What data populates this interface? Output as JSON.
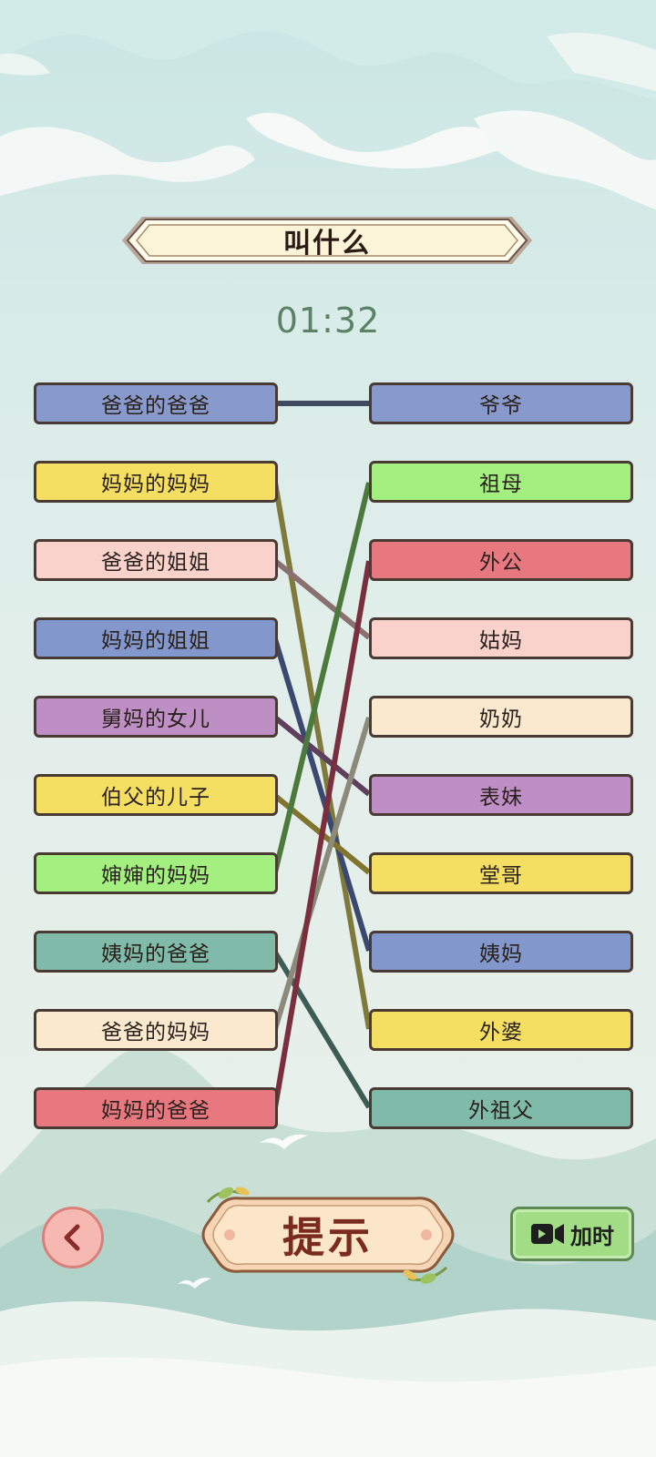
{
  "title": "叫什么",
  "timer": "01:32",
  "left_items": [
    {
      "label": "爸爸的爸爸",
      "color": "#8899cc"
    },
    {
      "label": "妈妈的妈妈",
      "color": "#f4df62"
    },
    {
      "label": "爸爸的姐姐",
      "color": "#f8d2cb"
    },
    {
      "label": "妈妈的姐姐",
      "color": "#8297cb"
    },
    {
      "label": "舅妈的女儿",
      "color": "#be8fc4"
    },
    {
      "label": "伯父的儿子",
      "color": "#f4df62"
    },
    {
      "label": "婶婶的妈妈",
      "color": "#a3ef7f"
    },
    {
      "label": "姨妈的爸爸",
      "color": "#80bba9"
    },
    {
      "label": "爸爸的妈妈",
      "color": "#fbe9cf"
    },
    {
      "label": "妈妈的爸爸",
      "color": "#e87880"
    }
  ],
  "right_items": [
    {
      "label": "爷爷",
      "color": "#8899cc"
    },
    {
      "label": "祖母",
      "color": "#a3ef7f"
    },
    {
      "label": "外公",
      "color": "#e87880"
    },
    {
      "label": "姑妈",
      "color": "#f8d2cb"
    },
    {
      "label": "奶奶",
      "color": "#fbe9cf"
    },
    {
      "label": "表妹",
      "color": "#be8fc4"
    },
    {
      "label": "堂哥",
      "color": "#f4df62"
    },
    {
      "label": "姨妈",
      "color": "#8297cb"
    },
    {
      "label": "外婆",
      "color": "#f4df62"
    },
    {
      "label": "外祖父",
      "color": "#80bba9"
    }
  ],
  "connections": [
    {
      "from": 0,
      "to": 0,
      "color": "#3f4a5f"
    },
    {
      "from": 1,
      "to": 8,
      "color": "#7f7a3c"
    },
    {
      "from": 2,
      "to": 3,
      "color": "#8a7070"
    },
    {
      "from": 3,
      "to": 7,
      "color": "#3b4870"
    },
    {
      "from": 4,
      "to": 5,
      "color": "#5e3f5e"
    },
    {
      "from": 5,
      "to": 6,
      "color": "#80742f"
    },
    {
      "from": 6,
      "to": 1,
      "color": "#4c7a3c"
    },
    {
      "from": 7,
      "to": 9,
      "color": "#3d5c55"
    },
    {
      "from": 8,
      "to": 4,
      "color": "#8c8a7a"
    },
    {
      "from": 9,
      "to": 2,
      "color": "#7a2f3f"
    }
  ],
  "buttons": {
    "back_icon": "chevron-left-icon",
    "hint": "提示",
    "add_time": "加时",
    "add_time_icon": "video-camera-icon"
  }
}
